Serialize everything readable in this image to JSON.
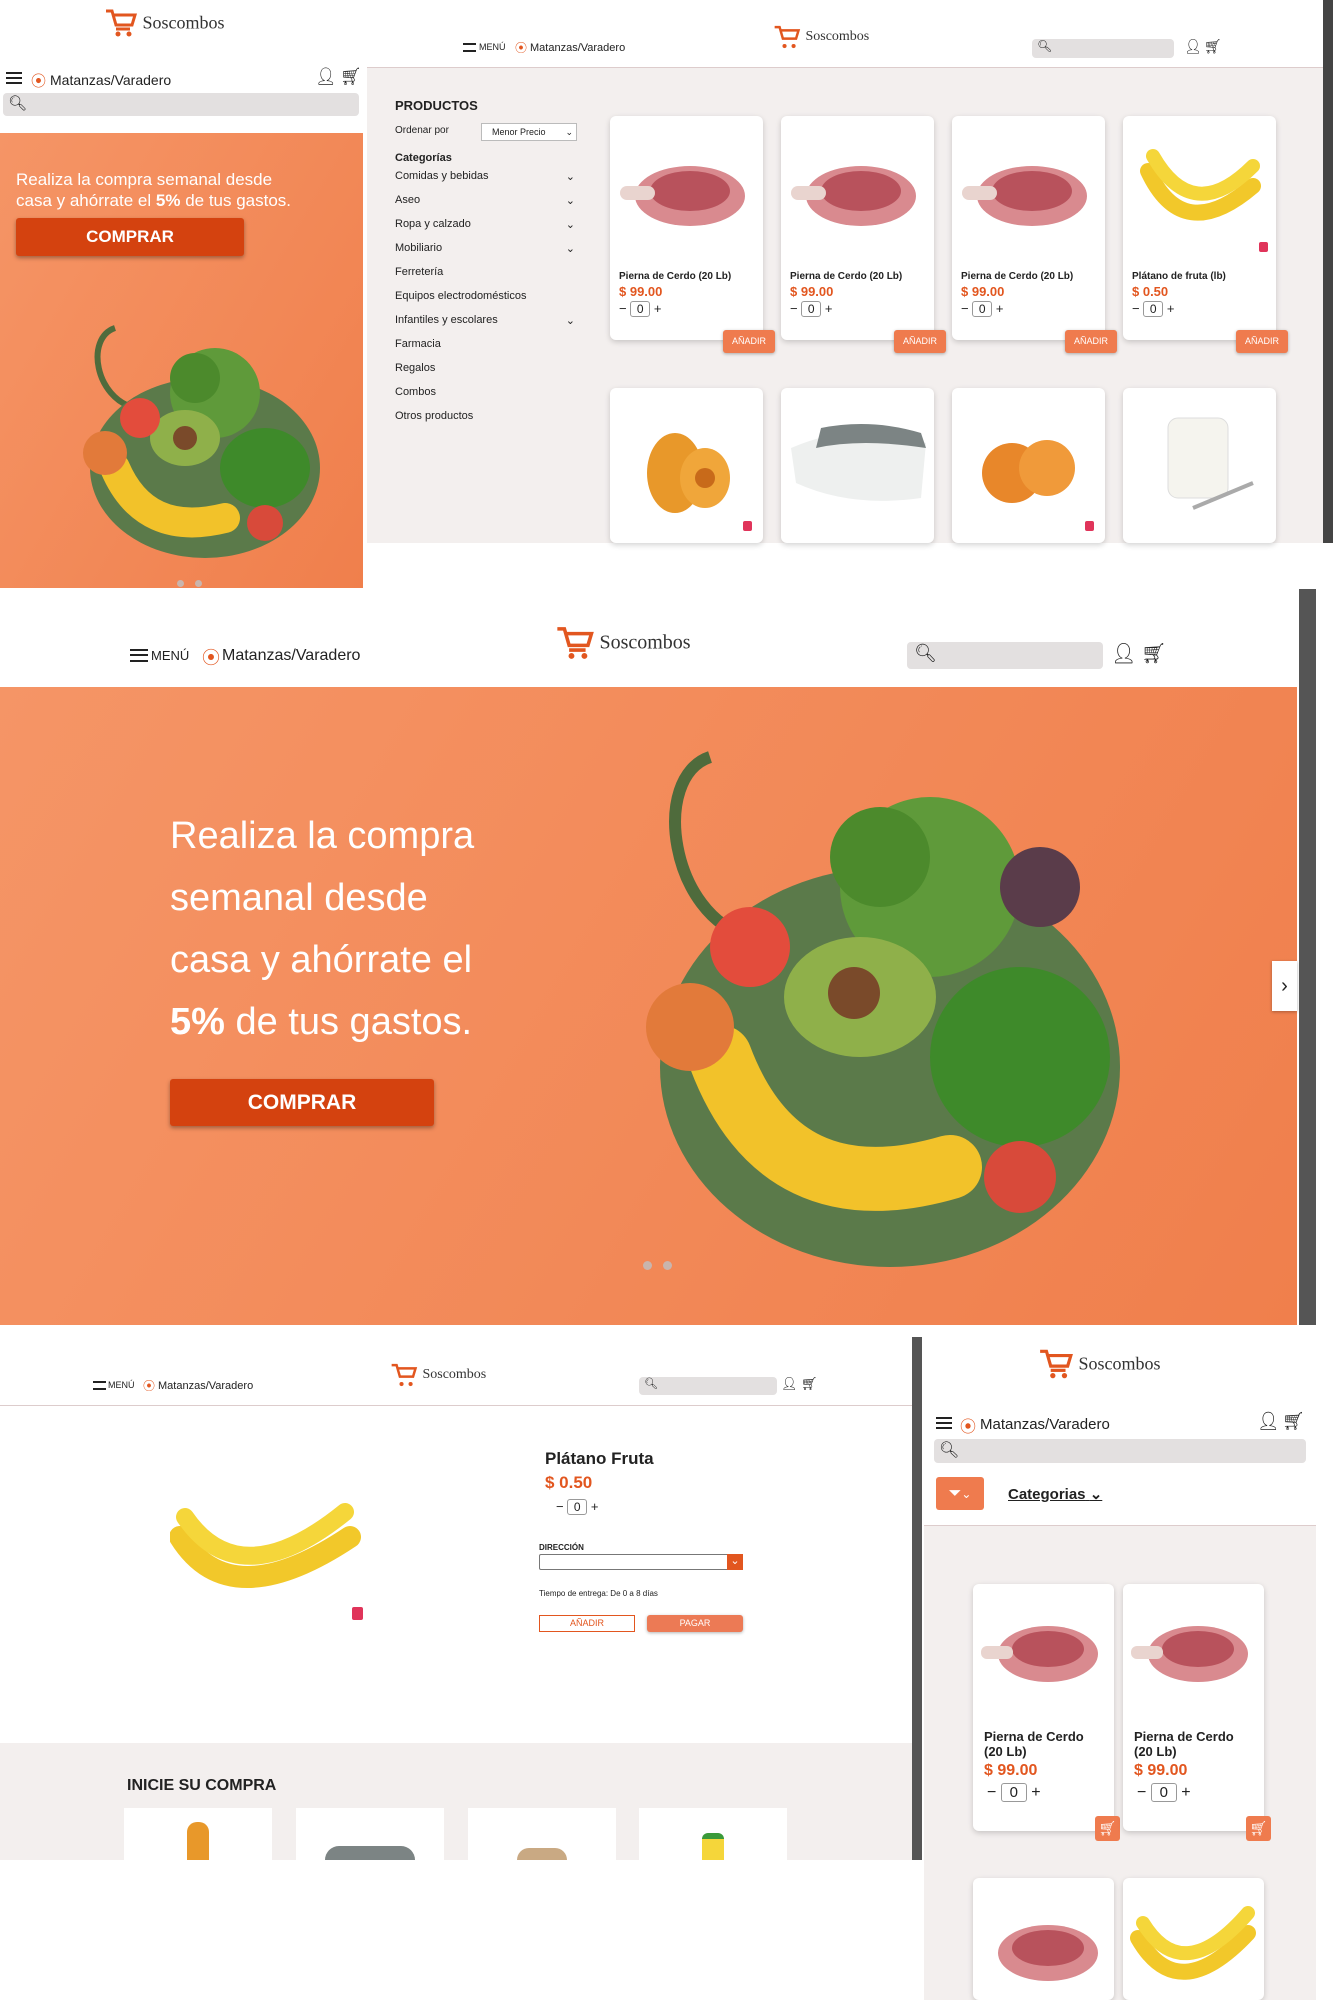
{
  "brand": {
    "name": "Soscombos"
  },
  "nav": {
    "menu_label": "MENÚ",
    "location": "Matanzas/Varadero"
  },
  "hero": {
    "line1": "Realiza la compra semanal desde",
    "line2": "casa y ahórrate el",
    "pct": "5%",
    "line3": "de tus gastos.",
    "big1": "Realiza la compra",
    "big2": "semanal desde",
    "big3": "casa y ahórrate el",
    "big4_rest": "de tus gastos.",
    "cta": "COMPRAR"
  },
  "catalog": {
    "title": "PRODUCTOS",
    "sort_label": "Ordenar por",
    "sort_value": "Menor Precio",
    "categories_title": "Categorías",
    "categories": [
      "Comidas y bebidas",
      "Aseo",
      "Ropa y calzado",
      "Mobiliario",
      "Ferretería",
      "Equipos electrodomésticos",
      "Infantiles y escolares",
      "Farmacia",
      "Regalos",
      "Combos",
      "Otros productos"
    ],
    "products": [
      {
        "name": "Pierna de Cerdo (20 Lb)",
        "price": "$ 99.00",
        "qty": "0",
        "add": "AÑADIR"
      },
      {
        "name": "Pierna de Cerdo (20 Lb)",
        "price": "$ 99.00",
        "qty": "0",
        "add": "AÑADIR"
      },
      {
        "name": "Pierna de Cerdo (20 Lb)",
        "price": "$ 99.00",
        "qty": "0",
        "add": "AÑADIR"
      },
      {
        "name": "Plátano de fruta (lb)",
        "price": "$ 0.50",
        "qty": "0",
        "add": "AÑADIR"
      }
    ]
  },
  "detail": {
    "name": "Plátano Fruta",
    "price": "$ 0.50",
    "qty": "0",
    "address_label": "DIRECCIÓN",
    "delivery": "Tiempo de entrega: De 0 a 8 días",
    "add": "AÑADIR",
    "pay": "PAGAR",
    "section": "INICIE SU COMPRA"
  },
  "mobile": {
    "categories_label": "Categorias",
    "products": [
      {
        "name": "Pierna de Cerdo (20 Lb)",
        "price": "$ 99.00",
        "qty": "0"
      },
      {
        "name": "Pierna de Cerdo (20 Lb)",
        "price": "$ 99.00",
        "qty": "0"
      }
    ]
  },
  "colors": {
    "accent": "#e2561f",
    "hero": "#f28a5a",
    "button": "#d4420f"
  }
}
